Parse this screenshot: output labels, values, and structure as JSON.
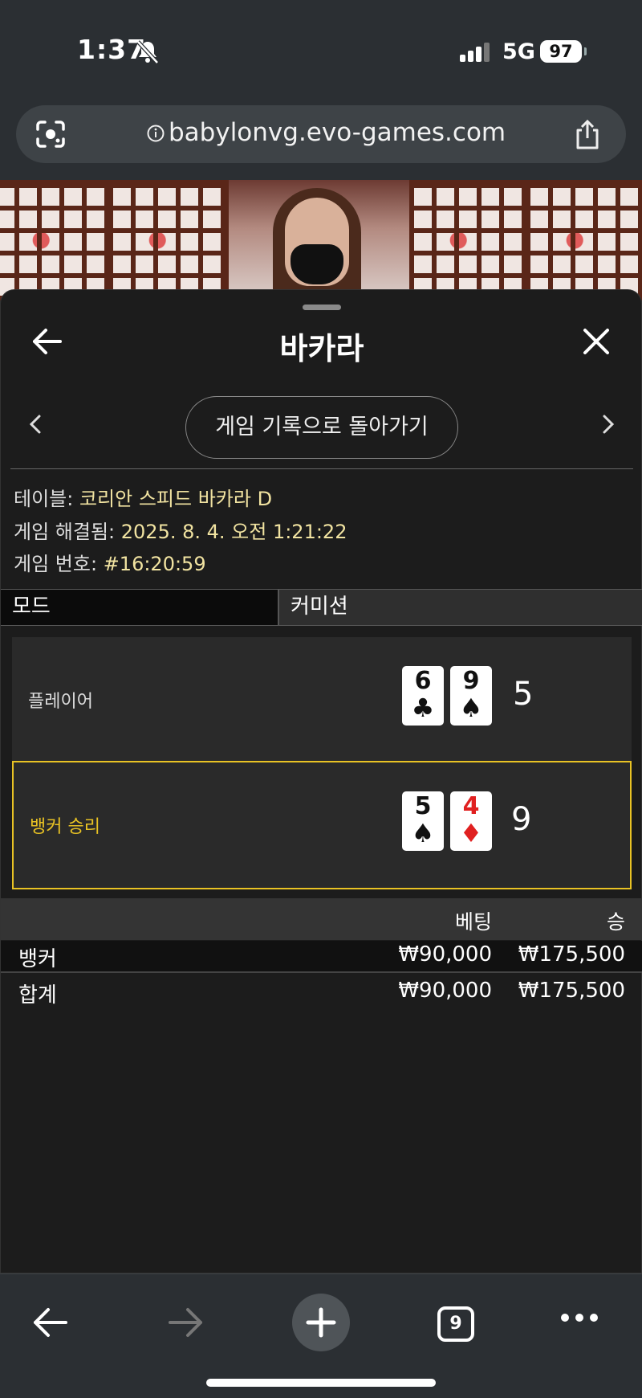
{
  "status_bar": {
    "time": "1:37",
    "network": "5G",
    "battery": "97"
  },
  "browser": {
    "url": "babylonvg.evo-games.com",
    "open_tabs_count": "9"
  },
  "panel": {
    "title": "바카라",
    "return_button_label": "게임 기록으로 돌아가기",
    "info": {
      "table_label": "테이블:",
      "table_value": "코리안 스피드 바카라 D",
      "resolved_label": "게임 해결됨:",
      "resolved_value": "2025. 8. 4. 오전 1:21:22",
      "number_label": "게임 번호:",
      "number_value": "#16:20:59"
    },
    "tabs": {
      "mode": "모드",
      "commission": "커미션"
    },
    "hands": {
      "player": {
        "label": "플레이어",
        "score": "5",
        "cards": [
          {
            "rank": "6",
            "suit": "♣",
            "color": "#111111"
          },
          {
            "rank": "9",
            "suit": "♠",
            "color": "#111111"
          }
        ]
      },
      "banker": {
        "label": "뱅커 승리",
        "score": "9",
        "cards": [
          {
            "rank": "5",
            "suit": "♠",
            "color": "#111111"
          },
          {
            "rank": "4",
            "suit": "♦",
            "color": "#e02020"
          }
        ]
      }
    },
    "bets": {
      "header_bet": "베팅",
      "header_win": "승",
      "rows": [
        {
          "name": "뱅커",
          "bet": "₩90,000",
          "win": "₩175,500"
        },
        {
          "name": "합계",
          "bet": "₩90,000",
          "win": "₩175,500"
        }
      ]
    }
  },
  "colors": {
    "accent_winner": "#e8c224",
    "info_value": "#f1e3a1"
  }
}
